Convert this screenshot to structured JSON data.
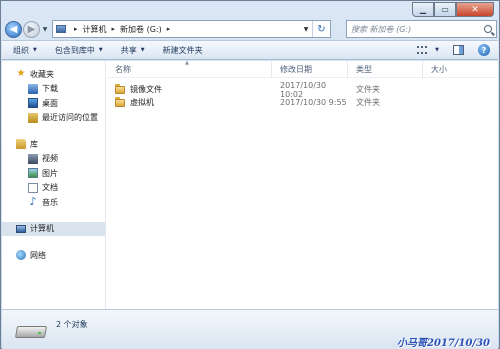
{
  "window": {
    "caption_buttons": {
      "minimize": "▁",
      "maximize": "▭",
      "close": "✕"
    }
  },
  "address_bar": {
    "back_glyph": "◀",
    "forward_glyph": "▶",
    "crumbs": [
      "计算机",
      "新加卷 (G:)"
    ],
    "separator": "▸",
    "dropdown_glyph": "▼",
    "refresh_glyph": "↻"
  },
  "search": {
    "placeholder": "搜索 新加卷 (G:)"
  },
  "toolbar": {
    "organize": "组织",
    "include_in_library": "包含到库中",
    "share": "共享",
    "new_folder": "新建文件夹",
    "arrow": "▼"
  },
  "nav": {
    "favorites": {
      "label": "收藏夹",
      "items": [
        "下载",
        "桌面",
        "最近访问的位置"
      ]
    },
    "libraries": {
      "label": "库",
      "items": [
        "视频",
        "图片",
        "文档",
        "音乐"
      ]
    },
    "computer": {
      "label": "计算机"
    },
    "network": {
      "label": "网络"
    }
  },
  "list": {
    "columns": [
      "名称",
      "修改日期",
      "类型",
      "大小"
    ],
    "rows": [
      {
        "name": "镜像文件",
        "date": "2017/10/30 10:02",
        "type": "文件夹",
        "size": ""
      },
      {
        "name": "虚拟机",
        "date": "2017/10/30 9:55",
        "type": "文件夹",
        "size": ""
      }
    ]
  },
  "details": {
    "count": "2 个对象"
  },
  "watermark": "小马哥2017/10/30",
  "icons": [
    "back-icon",
    "forward-icon",
    "computer-icon",
    "refresh-icon",
    "search-icon",
    "view-icon",
    "preview-pane-icon",
    "help-icon",
    "star-icon",
    "download-icon",
    "desktop-icon",
    "recent-places-icon",
    "library-icon",
    "video-icon",
    "picture-icon",
    "document-icon",
    "music-icon",
    "network-icon",
    "folder-icon",
    "drive-icon"
  ]
}
